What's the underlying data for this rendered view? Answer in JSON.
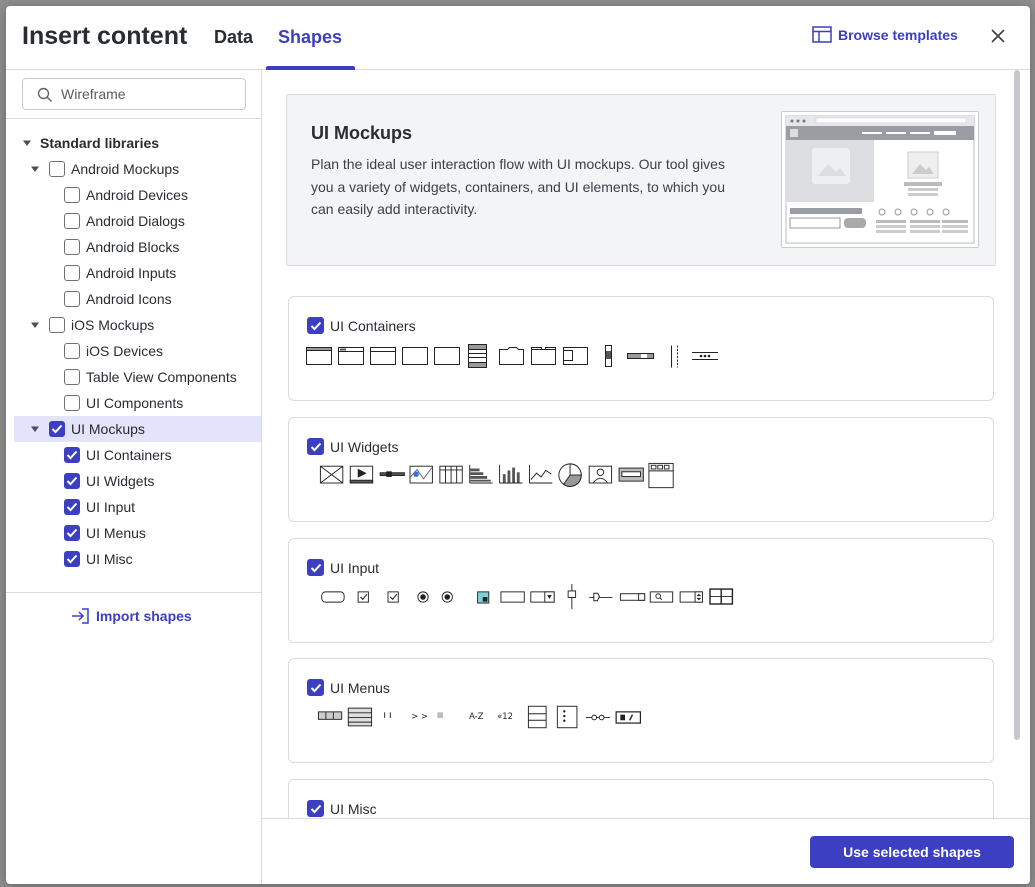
{
  "header": {
    "title": "Insert content",
    "tabs": [
      {
        "label": "Data"
      },
      {
        "label": "Shapes"
      }
    ],
    "active_tab": "Shapes",
    "browse_label": "Browse templates"
  },
  "sidebar": {
    "search_value": "Wireframe",
    "section_label": "Standard libraries",
    "items": [
      {
        "label": "Android Mockups",
        "level": 1,
        "checked": false,
        "expanded": true
      },
      {
        "label": "Android Devices",
        "level": 2,
        "checked": false
      },
      {
        "label": "Android Dialogs",
        "level": 2,
        "checked": false
      },
      {
        "label": "Android Blocks",
        "level": 2,
        "checked": false
      },
      {
        "label": "Android Inputs",
        "level": 2,
        "checked": false
      },
      {
        "label": "Android Icons",
        "level": 2,
        "checked": false
      },
      {
        "label": "iOS Mockups",
        "level": 1,
        "checked": false,
        "expanded": true
      },
      {
        "label": "iOS Devices",
        "level": 2,
        "checked": false
      },
      {
        "label": "Table View Components",
        "level": 2,
        "checked": false
      },
      {
        "label": "UI Components",
        "level": 2,
        "checked": false
      },
      {
        "label": "UI Mockups",
        "level": 1,
        "checked": true,
        "expanded": true,
        "selected": true
      },
      {
        "label": "UI Containers",
        "level": 2,
        "checked": true
      },
      {
        "label": "UI Widgets",
        "level": 2,
        "checked": true
      },
      {
        "label": "UI Input",
        "level": 2,
        "checked": true
      },
      {
        "label": "UI Menus",
        "level": 2,
        "checked": true
      },
      {
        "label": "UI Misc",
        "level": 2,
        "checked": true
      }
    ],
    "import_label": "Import shapes"
  },
  "main": {
    "hero": {
      "title": "UI Mockups",
      "description": "Plan the ideal user interaction flow with UI mockups. Our tool gives you a variety of widgets, containers, and UI elements, to which you can easily add interactivity."
    },
    "cards": [
      {
        "label": "UI Containers",
        "checked": true
      },
      {
        "label": "UI Widgets",
        "checked": true
      },
      {
        "label": "UI Input",
        "checked": true
      },
      {
        "label": "UI Menus",
        "checked": true
      },
      {
        "label": "UI Misc",
        "checked": true
      }
    ],
    "menu_text_shapes": {
      "az": "A-Z",
      "nums": "«12",
      "arrows": "> >"
    }
  },
  "footer": {
    "primary_label": "Use selected shapes"
  },
  "colors": {
    "accent": "#3d3fc2",
    "selected_row": "#e3e3fb",
    "border": "#d9dbe0"
  }
}
